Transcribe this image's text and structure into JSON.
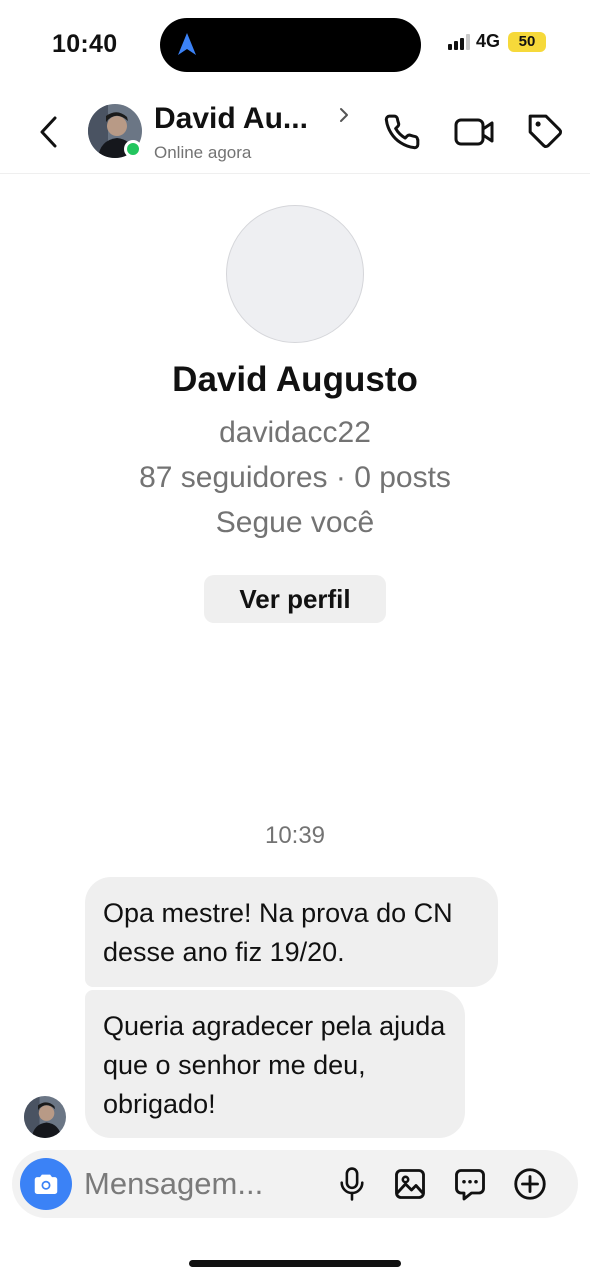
{
  "status_bar": {
    "time": "10:40",
    "network": "4G",
    "battery": "50",
    "icons": [
      "location-arrow-icon",
      "signal-icon"
    ],
    "battery_color": "#f6d93a"
  },
  "header": {
    "name": "David Au...",
    "status": "Online agora",
    "icons": [
      "back-chevron-icon",
      "avatar",
      "chevron-right-icon",
      "phone-icon",
      "video-camera-icon",
      "tag-icon"
    ],
    "online_color": "#22c55e"
  },
  "profile": {
    "name": "David Augusto",
    "username": "davidacc22",
    "stats": "87 seguidores · 0 posts",
    "follows_you": "Segue você",
    "view_profile_label": "Ver perfil"
  },
  "messages": {
    "timestamp": "10:39",
    "items": [
      {
        "text": "Opa mestre! Na prova do CN desse ano fiz 19/20."
      },
      {
        "text": "Queria agradecer pela ajuda que o senhor me deu, obrigado!"
      }
    ]
  },
  "composer": {
    "placeholder": "Mensagem...",
    "icons": [
      "camera-icon",
      "microphone-icon",
      "image-icon",
      "sticker-icon",
      "plus-icon"
    ],
    "camera_color": "#3b82f6"
  }
}
